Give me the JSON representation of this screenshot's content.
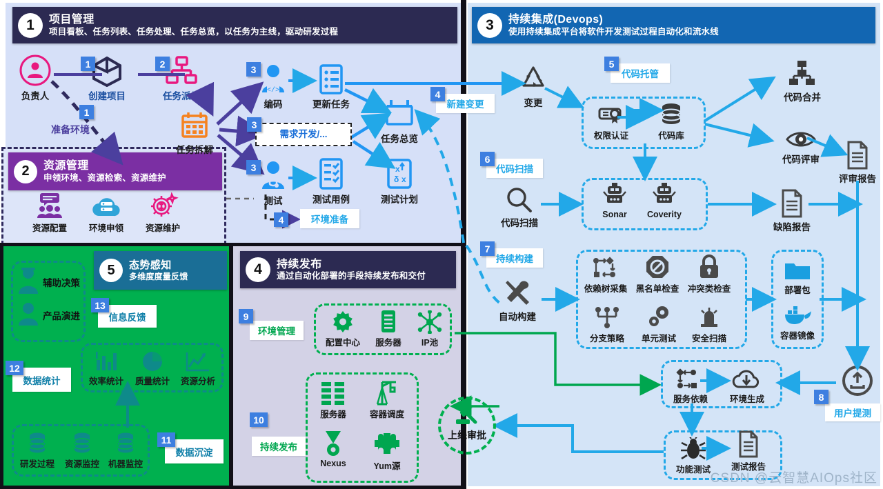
{
  "theme": {
    "navy": "#2c2a52",
    "purple": "#7b2fa3",
    "blue": "#1266b2",
    "teal": "#1a6e96",
    "green": "#00b04f",
    "cyan": "#22a8e8",
    "chip_blue": "#3d7fe0"
  },
  "sections": {
    "s1": {
      "num": "1",
      "title": "项目管理",
      "subtitle": "项目看板、任务列表、任务处理、任务总览，以任务为主线，驱动研发过程"
    },
    "s2": {
      "num": "2",
      "title": "资源管理",
      "subtitle": "申领环境、资源检索、资源维护"
    },
    "s3": {
      "num": "3",
      "title": "持续集成(Devops)",
      "subtitle": "使用持续集成平台将软件开发测试过程自动化和流水线"
    },
    "s4": {
      "num": "4",
      "title": "持续发布",
      "subtitle": "通过自动化部署的手段持续发布和交付"
    },
    "s5": {
      "num": "5",
      "title": "态势感知",
      "subtitle": "多维度度量反馈"
    }
  },
  "panel1": {
    "nodes": [
      {
        "id": "owner",
        "label": "负责人",
        "icon": "person-circle-icon"
      },
      {
        "id": "create",
        "label": "创建项目",
        "icon": "cube-icon"
      },
      {
        "id": "dispatch",
        "label": "任务派发",
        "icon": "org-tree-icon"
      },
      {
        "id": "split",
        "label": "任务拆解",
        "icon": "calendar-icon"
      },
      {
        "id": "coding",
        "label": "编码",
        "icon": "developer-icon"
      },
      {
        "id": "update",
        "label": "更新任务",
        "icon": "list-icon"
      },
      {
        "id": "overview",
        "label": "任务总览",
        "icon": "board-icon"
      },
      {
        "id": "testing",
        "label": "测试",
        "icon": "tester-icon"
      },
      {
        "id": "testcase",
        "label": "测试用例",
        "icon": "checklist-icon"
      },
      {
        "id": "testplan",
        "label": "测试计划",
        "icon": "testplan-icon"
      }
    ],
    "chips": [
      {
        "n": "1",
        "for": "create"
      },
      {
        "n": "2",
        "for": "dispatch"
      },
      {
        "n": "1",
        "for": "prepare-env"
      },
      {
        "n": "3",
        "for": "coding"
      },
      {
        "n": "3",
        "for": "req-dev"
      },
      {
        "n": "3",
        "for": "testing"
      },
      {
        "n": "4",
        "for": "env-prepare"
      },
      {
        "n": "4",
        "for": "new-change"
      }
    ],
    "labels": {
      "prepare_env": "准备环境",
      "req_dev": "需求开发/...",
      "env_prepare": "环境准备",
      "new_change": "新建变更"
    }
  },
  "panel2": {
    "nodes": [
      {
        "id": "res-config",
        "label": "资源配置",
        "icon": "users-config-icon"
      },
      {
        "id": "env-apply",
        "label": "环境申领",
        "icon": "cloud-server-icon"
      },
      {
        "id": "res-maintain",
        "label": "资源维护",
        "icon": "gear-money-icon"
      }
    ]
  },
  "panel3": {
    "chips": [
      {
        "n": "5",
        "for": "code-hosting"
      },
      {
        "n": "6",
        "for": "code-scan"
      },
      {
        "n": "7",
        "for": "continuous-build"
      },
      {
        "n": "8",
        "for": "user-submit-test"
      }
    ],
    "labels": {
      "code_hosting": "代码托管",
      "code_scan": "代码扫描",
      "continuous_build": "持续构建",
      "user_submit_test": "用户提测"
    },
    "nodes": [
      {
        "id": "change",
        "label": "变更",
        "icon": "recycle-icon"
      },
      {
        "id": "auth",
        "label": "权限认证",
        "icon": "certificate-icon"
      },
      {
        "id": "repo",
        "label": "代码库",
        "icon": "database-icon"
      },
      {
        "id": "merge",
        "label": "代码合并",
        "icon": "merge-tree-icon"
      },
      {
        "id": "review",
        "label": "代码评审",
        "icon": "eye-icon"
      },
      {
        "id": "review-report",
        "label": "评审报告",
        "icon": "document-icon"
      },
      {
        "id": "scan",
        "label": "代码扫描",
        "icon": "magnifier-icon"
      },
      {
        "id": "sonar",
        "label": "Sonar",
        "icon": "robot-icon"
      },
      {
        "id": "coverity",
        "label": "Coverity",
        "icon": "robot-icon"
      },
      {
        "id": "defect",
        "label": "缺陷报告",
        "icon": "document-icon"
      },
      {
        "id": "autobuild",
        "label": "自动构建",
        "icon": "tools-icon"
      },
      {
        "id": "dep-tree",
        "label": "依赖树采集",
        "icon": "dependency-icon"
      },
      {
        "id": "blacklist",
        "label": "黑名单检查",
        "icon": "forbidden-icon"
      },
      {
        "id": "conflict",
        "label": "冲突类检查",
        "icon": "lock-icon"
      },
      {
        "id": "branch",
        "label": "分支策略",
        "icon": "branch-icon"
      },
      {
        "id": "unittest",
        "label": "单元测试",
        "icon": "gears-icon"
      },
      {
        "id": "secscan",
        "label": "安全扫描",
        "icon": "alarm-icon"
      },
      {
        "id": "package",
        "label": "部署包",
        "icon": "folder-icon"
      },
      {
        "id": "image",
        "label": "容器镜像",
        "icon": "whale-icon"
      },
      {
        "id": "svc-dep",
        "label": "服务依赖",
        "icon": "dependency-icon"
      },
      {
        "id": "env-gen",
        "label": "环境生成",
        "icon": "cloud-download-icon"
      },
      {
        "id": "func-test",
        "label": "功能测试",
        "icon": "bug-icon"
      },
      {
        "id": "test-report",
        "label": "测试报告",
        "icon": "document-icon"
      },
      {
        "id": "upload",
        "label": "",
        "icon": "upload-circle-icon"
      }
    ]
  },
  "panel4": {
    "chips": [
      {
        "n": "9",
        "for": "env-manage"
      },
      {
        "n": "10",
        "for": "continuous-release"
      }
    ],
    "labels": {
      "env_manage": "环境管理",
      "continuous_release": "持续发布"
    },
    "nodes": [
      {
        "id": "config-center",
        "label": "配置中心",
        "icon": "gear-icon"
      },
      {
        "id": "server",
        "label": "服务器",
        "icon": "rack-icon"
      },
      {
        "id": "ip-pool",
        "label": "IP池",
        "icon": "network-icon"
      },
      {
        "id": "servers2",
        "label": "服务器",
        "icon": "servers-icon"
      },
      {
        "id": "container-sch",
        "label": "容器调度",
        "icon": "crane-icon"
      },
      {
        "id": "nexus",
        "label": "Nexus",
        "icon": "medal-icon"
      },
      {
        "id": "yum",
        "label": "Yum源",
        "icon": "puzzle-icon"
      }
    ]
  },
  "panel5": {
    "chips": [
      {
        "n": "11",
        "for": "data-precipitation"
      },
      {
        "n": "12",
        "for": "data-stats"
      },
      {
        "n": "13",
        "for": "info-feedback"
      }
    ],
    "labels": {
      "info_feedback": "信息反馈",
      "data_stats": "数据统计",
      "data_precipitation": "数据沉淀"
    },
    "nodes": [
      {
        "id": "decision",
        "label": "辅助决策",
        "icon": "person-icon"
      },
      {
        "id": "product",
        "label": "产品演进",
        "icon": "cloud-icon"
      },
      {
        "id": "eff-stat",
        "label": "效率统计",
        "icon": "bar-chart-icon"
      },
      {
        "id": "qual-stat",
        "label": "质量统计",
        "icon": "pie-chart-icon"
      },
      {
        "id": "res-anal",
        "label": "资源分析",
        "icon": "line-chart-icon"
      },
      {
        "id": "rd-process",
        "label": "研发过程",
        "icon": "db-icon"
      },
      {
        "id": "res-mon",
        "label": "资源监控",
        "icon": "db-icon"
      },
      {
        "id": "machine-mon",
        "label": "机器监控",
        "icon": "db-icon"
      }
    ]
  },
  "approval": {
    "label": "上线审批",
    "icon": "gavel-icon"
  },
  "watermark": "CSDN @云智慧AIOps社区"
}
